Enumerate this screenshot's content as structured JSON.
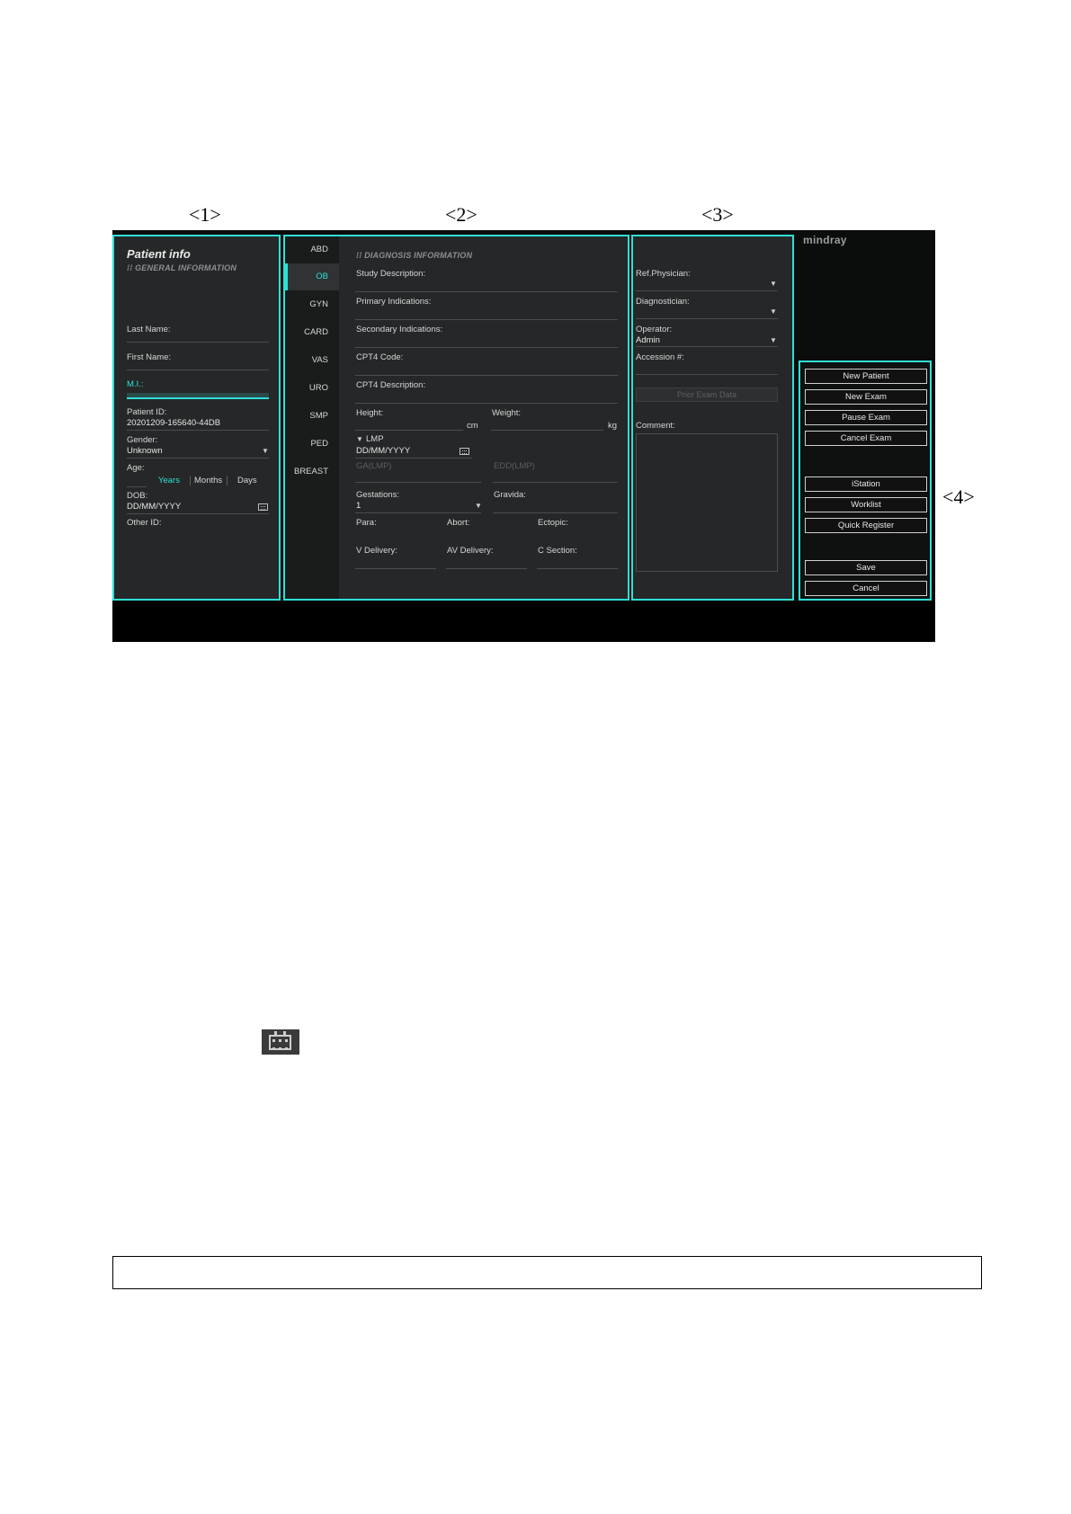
{
  "callouts": [
    "<1>",
    "<2>",
    "<3>",
    "<4>"
  ],
  "brand": "mindray",
  "patient_info": {
    "title": "Patient info",
    "section": "GENERAL INFORMATION",
    "last_name_label": "Last Name:",
    "first_name_label": "First Name:",
    "mi_label": "M.I.:",
    "patient_id_label": "Patient ID:",
    "patient_id_value": "20201209-165640-44DB",
    "gender_label": "Gender:",
    "gender_value": "Unknown",
    "age_label": "Age:",
    "age_units": [
      "Years",
      "Months",
      "Days"
    ],
    "dob_label": "DOB:",
    "dob_value": "DD/MM/YYYY",
    "other_id_label": "Other ID:"
  },
  "exam_tabs": [
    "ABD",
    "OB",
    "GYN",
    "CARD",
    "VAS",
    "URO",
    "SMP",
    "PED",
    "BREAST"
  ],
  "active_tab": "OB",
  "diagnosis": {
    "section": "DIAGNOSIS INFORMATION",
    "study_description": "Study Description:",
    "primary_indications": "Primary Indications:",
    "secondary_indications": "Secondary Indications:",
    "cpt4_code": "CPT4 Code:",
    "cpt4_description": "CPT4 Description:",
    "height_label": "Height:",
    "height_unit": "cm",
    "weight_label": "Weight:",
    "weight_unit": "kg",
    "lmp_label": "LMP",
    "lmp_value": "DD/MM/YYYY",
    "ga_lmp": "GA(LMP)",
    "edd_lmp": "EDD(LMP)",
    "gestations_label": "Gestations:",
    "gestations_value": "1",
    "gravida_label": "Gravida:",
    "para_label": "Para:",
    "abort_label": "Abort:",
    "ectopic_label": "Ectopic:",
    "v_delivery_label": "V Delivery:",
    "av_delivery_label": "AV Delivery:",
    "c_section_label": "C Section:"
  },
  "staff": {
    "ref_physician_label": "Ref.Physician:",
    "diagnostician_label": "Diagnostician:",
    "operator_label": "Operator:",
    "operator_value": "Admin",
    "accession_label": "Accession #:",
    "prior_exam_button": "Prior Exam Data",
    "comment_label": "Comment:"
  },
  "actions": {
    "new_patient": "New Patient",
    "new_exam": "New Exam",
    "pause_exam": "Pause Exam",
    "cancel_exam": "Cancel Exam",
    "istation": "iStation",
    "worklist": "Worklist",
    "quick_register": "Quick Register",
    "save": "Save",
    "cancel": "Cancel"
  },
  "accent_color": "#2ee0d6"
}
